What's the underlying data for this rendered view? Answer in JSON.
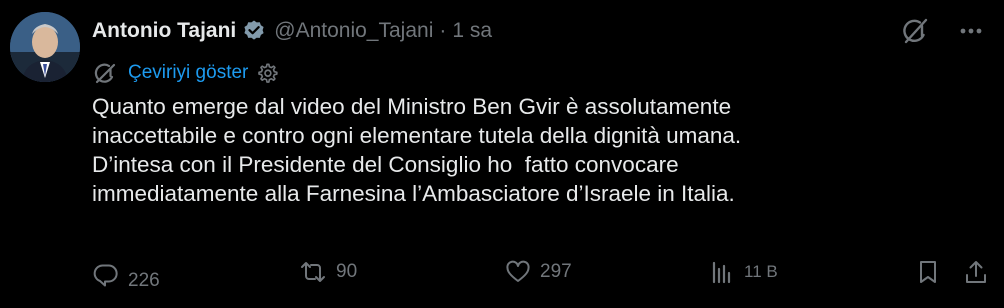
{
  "author": {
    "name": "Antonio Tajani",
    "handle": "@Antonio_Tajani",
    "separator": "·",
    "time": "1 sa"
  },
  "translate": {
    "label": "Çeviriyi göster"
  },
  "tweet": {
    "lines": [
      "Quanto emerge dal video del Ministro Ben Gvir è assolutamente",
      "inaccettabile e contro ogni elementare tutela della dignità umana.",
      "D’intesa con il Presidente del Consiglio ho  fatto convocare",
      "immediatamente alla Farnesina l’Ambasciatore d’Israele in Italia."
    ]
  },
  "actions": {
    "reply_count": "226",
    "retweet_count": "90",
    "like_count": "297",
    "views_count": "11 B"
  },
  "colors": {
    "background": "#000000",
    "text": "#e7e9ea",
    "muted": "#71767b",
    "accent": "#1d9bf0"
  },
  "icons": [
    "verified-badge-icon",
    "grok-icon",
    "more-icon",
    "translate-icon",
    "gear-icon",
    "reply-icon",
    "retweet-icon",
    "like-icon",
    "views-icon",
    "bookmark-icon",
    "share-icon"
  ]
}
